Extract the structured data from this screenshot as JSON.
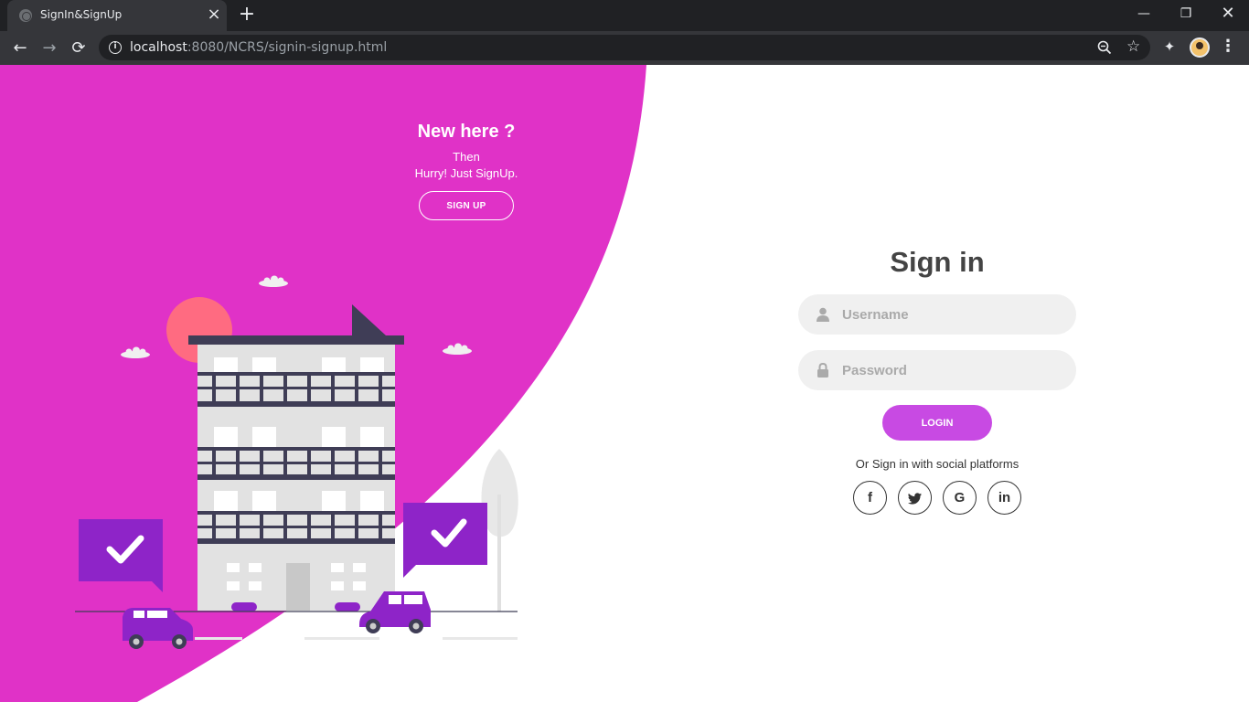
{
  "browser": {
    "tab_title": "SignIn&SignUp",
    "url_host": "localhost",
    "url_rest": ":8080/NCRS/signin-signup.html"
  },
  "promo": {
    "title": "New here ?",
    "line1": "Then",
    "line2": "Hurry! Just SignUp.",
    "button": "SIGN UP"
  },
  "signin": {
    "title": "Sign in",
    "username_placeholder": "Username",
    "password_placeholder": "Password",
    "login_button": "LOGIN",
    "social_text": "Or Sign in with social platforms",
    "social": [
      {
        "icon": "facebook-icon",
        "glyph": "f"
      },
      {
        "icon": "twitter-icon",
        "glyph": "t"
      },
      {
        "icon": "google-icon",
        "glyph": "G"
      },
      {
        "icon": "linkedin-icon",
        "glyph": "in"
      }
    ]
  },
  "colors": {
    "brand_magenta": "#e032c7",
    "button_purple": "#c84ae3",
    "illustration_purple": "#8e24c8",
    "sun": "#ff6b81"
  }
}
